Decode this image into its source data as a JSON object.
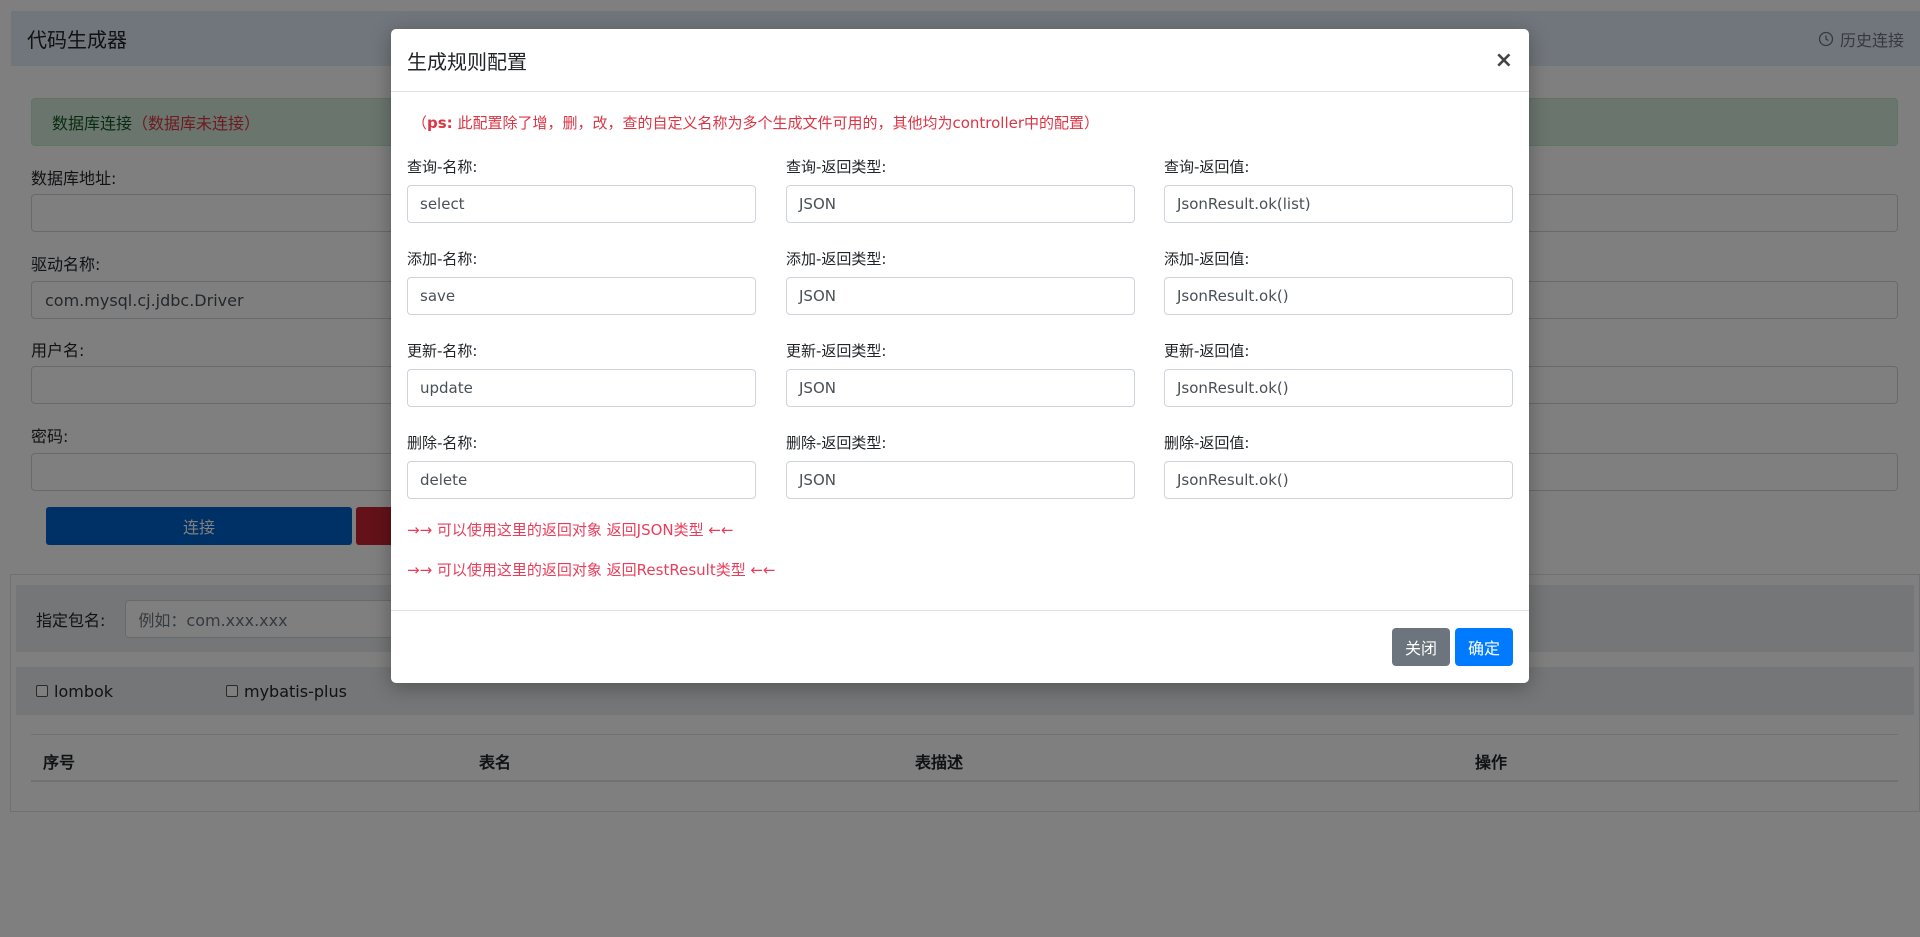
{
  "navbar": {
    "brand": "代码生成器",
    "history_label": "历史连接"
  },
  "alert": {
    "prefix": "数据库连接",
    "status": "（数据库未连接）"
  },
  "form": {
    "db_url_label": "数据库地址:",
    "db_url_value": "",
    "driver_label": "驱动名称:",
    "driver_value": "com.mysql.cj.jdbc.Driver",
    "username_label": "用户名:",
    "username_value": "",
    "password_label": "密码:",
    "password_value": "",
    "connect_label": "连接"
  },
  "package": {
    "label": "指定包名:",
    "placeholder": "例如：com.xxx.xxx"
  },
  "options": [
    {
      "label": "lombok",
      "checked": false
    },
    {
      "label": "mybatis-plus",
      "checked": false
    }
  ],
  "table": {
    "headers": [
      "序号",
      "表名",
      "表描述",
      "操作"
    ]
  },
  "modal": {
    "title": "生成规则配置",
    "close_glyph": "×",
    "ps_bold": "ps:",
    "ps_text": "此配置除了增，删，改，查的自定义名称为多个生成文件可用的，其他均为controller中的配置）",
    "ps_open": "（",
    "rows": [
      {
        "name_label": "查询-名称:",
        "name_value": "select",
        "type_label": "查询-返回类型:",
        "type_value": "JSON",
        "ret_label": "查询-返回值:",
        "ret_value": "JsonResult.ok(list)"
      },
      {
        "name_label": "添加-名称:",
        "name_value": "save",
        "type_label": "添加-返回类型:",
        "type_value": "JSON",
        "ret_label": "添加-返回值:",
        "ret_value": "JsonResult.ok()"
      },
      {
        "name_label": "更新-名称:",
        "name_value": "update",
        "type_label": "更新-返回类型:",
        "type_value": "JSON",
        "ret_label": "更新-返回值:",
        "ret_value": "JsonResult.ok()"
      },
      {
        "name_label": "删除-名称:",
        "name_value": "delete",
        "type_label": "删除-返回类型:",
        "type_value": "JSON",
        "ret_label": "删除-返回值:",
        "ret_value": "JsonResult.ok()"
      }
    ],
    "hint_json": "→→ 可以使用这里的返回对象 返回JSON类型 ←←",
    "hint_rest": "→→ 可以使用这里的返回对象 返回RestResult类型 ←←",
    "close_button": "关闭",
    "confirm_button": "确定"
  },
  "colors": {
    "primary": "#007bff",
    "danger": "#dc3545",
    "secondary": "#6c757d",
    "success_bg": "#d4edda"
  },
  "icons": {
    "history": "clock-icon",
    "close": "close-icon"
  }
}
